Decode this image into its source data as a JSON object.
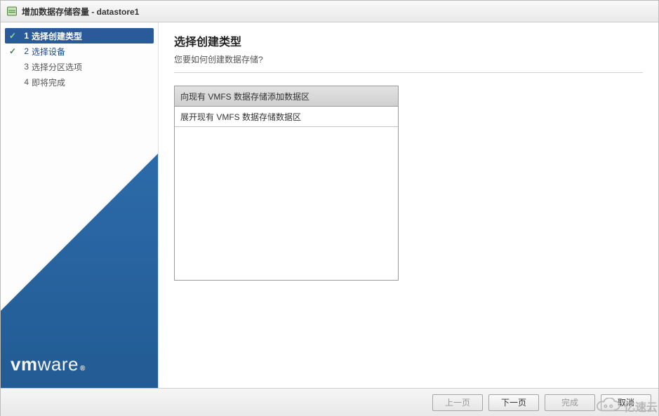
{
  "title": "增加数据存储容量 - datastore1",
  "steps": [
    {
      "idx": "1",
      "label": "选择创建类型",
      "state": "active",
      "checked": true
    },
    {
      "idx": "2",
      "label": "选择设备",
      "state": "done",
      "checked": true
    },
    {
      "idx": "3",
      "label": "选择分区选项",
      "state": "pending",
      "checked": false
    },
    {
      "idx": "4",
      "label": "即将完成",
      "state": "pending",
      "checked": false
    }
  ],
  "main": {
    "heading": "选择创建类型",
    "subtitle": "您要如何创建数据存储?",
    "options": [
      {
        "label": "向现有 VMFS 数据存储添加数据区",
        "selected": true
      },
      {
        "label": "展开现有 VMFS 数据存储数据区",
        "selected": false
      }
    ]
  },
  "footer": {
    "back": "上一页",
    "next": "下一页",
    "finish": "完成",
    "cancel": "取消"
  },
  "logo": {
    "vm": "vm",
    "ware": "ware",
    "r": "®"
  },
  "watermark": {
    "text": "亿速云"
  }
}
